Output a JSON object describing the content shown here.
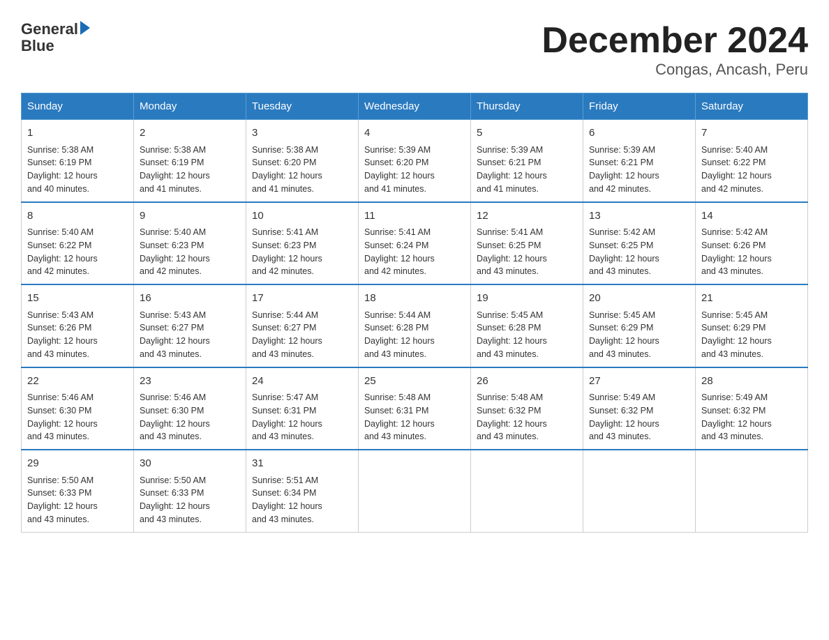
{
  "logo": {
    "line1": "General",
    "line2": "Blue"
  },
  "title": "December 2024",
  "subtitle": "Congas, Ancash, Peru",
  "days": [
    "Sunday",
    "Monday",
    "Tuesday",
    "Wednesday",
    "Thursday",
    "Friday",
    "Saturday"
  ],
  "weeks": [
    [
      {
        "num": "1",
        "sunrise": "5:38 AM",
        "sunset": "6:19 PM",
        "daylight": "12 hours and 40 minutes."
      },
      {
        "num": "2",
        "sunrise": "5:38 AM",
        "sunset": "6:19 PM",
        "daylight": "12 hours and 41 minutes."
      },
      {
        "num": "3",
        "sunrise": "5:38 AM",
        "sunset": "6:20 PM",
        "daylight": "12 hours and 41 minutes."
      },
      {
        "num": "4",
        "sunrise": "5:39 AM",
        "sunset": "6:20 PM",
        "daylight": "12 hours and 41 minutes."
      },
      {
        "num": "5",
        "sunrise": "5:39 AM",
        "sunset": "6:21 PM",
        "daylight": "12 hours and 41 minutes."
      },
      {
        "num": "6",
        "sunrise": "5:39 AM",
        "sunset": "6:21 PM",
        "daylight": "12 hours and 42 minutes."
      },
      {
        "num": "7",
        "sunrise": "5:40 AM",
        "sunset": "6:22 PM",
        "daylight": "12 hours and 42 minutes."
      }
    ],
    [
      {
        "num": "8",
        "sunrise": "5:40 AM",
        "sunset": "6:22 PM",
        "daylight": "12 hours and 42 minutes."
      },
      {
        "num": "9",
        "sunrise": "5:40 AM",
        "sunset": "6:23 PM",
        "daylight": "12 hours and 42 minutes."
      },
      {
        "num": "10",
        "sunrise": "5:41 AM",
        "sunset": "6:23 PM",
        "daylight": "12 hours and 42 minutes."
      },
      {
        "num": "11",
        "sunrise": "5:41 AM",
        "sunset": "6:24 PM",
        "daylight": "12 hours and 42 minutes."
      },
      {
        "num": "12",
        "sunrise": "5:41 AM",
        "sunset": "6:25 PM",
        "daylight": "12 hours and 43 minutes."
      },
      {
        "num": "13",
        "sunrise": "5:42 AM",
        "sunset": "6:25 PM",
        "daylight": "12 hours and 43 minutes."
      },
      {
        "num": "14",
        "sunrise": "5:42 AM",
        "sunset": "6:26 PM",
        "daylight": "12 hours and 43 minutes."
      }
    ],
    [
      {
        "num": "15",
        "sunrise": "5:43 AM",
        "sunset": "6:26 PM",
        "daylight": "12 hours and 43 minutes."
      },
      {
        "num": "16",
        "sunrise": "5:43 AM",
        "sunset": "6:27 PM",
        "daylight": "12 hours and 43 minutes."
      },
      {
        "num": "17",
        "sunrise": "5:44 AM",
        "sunset": "6:27 PM",
        "daylight": "12 hours and 43 minutes."
      },
      {
        "num": "18",
        "sunrise": "5:44 AM",
        "sunset": "6:28 PM",
        "daylight": "12 hours and 43 minutes."
      },
      {
        "num": "19",
        "sunrise": "5:45 AM",
        "sunset": "6:28 PM",
        "daylight": "12 hours and 43 minutes."
      },
      {
        "num": "20",
        "sunrise": "5:45 AM",
        "sunset": "6:29 PM",
        "daylight": "12 hours and 43 minutes."
      },
      {
        "num": "21",
        "sunrise": "5:45 AM",
        "sunset": "6:29 PM",
        "daylight": "12 hours and 43 minutes."
      }
    ],
    [
      {
        "num": "22",
        "sunrise": "5:46 AM",
        "sunset": "6:30 PM",
        "daylight": "12 hours and 43 minutes."
      },
      {
        "num": "23",
        "sunrise": "5:46 AM",
        "sunset": "6:30 PM",
        "daylight": "12 hours and 43 minutes."
      },
      {
        "num": "24",
        "sunrise": "5:47 AM",
        "sunset": "6:31 PM",
        "daylight": "12 hours and 43 minutes."
      },
      {
        "num": "25",
        "sunrise": "5:48 AM",
        "sunset": "6:31 PM",
        "daylight": "12 hours and 43 minutes."
      },
      {
        "num": "26",
        "sunrise": "5:48 AM",
        "sunset": "6:32 PM",
        "daylight": "12 hours and 43 minutes."
      },
      {
        "num": "27",
        "sunrise": "5:49 AM",
        "sunset": "6:32 PM",
        "daylight": "12 hours and 43 minutes."
      },
      {
        "num": "28",
        "sunrise": "5:49 AM",
        "sunset": "6:32 PM",
        "daylight": "12 hours and 43 minutes."
      }
    ],
    [
      {
        "num": "29",
        "sunrise": "5:50 AM",
        "sunset": "6:33 PM",
        "daylight": "12 hours and 43 minutes."
      },
      {
        "num": "30",
        "sunrise": "5:50 AM",
        "sunset": "6:33 PM",
        "daylight": "12 hours and 43 minutes."
      },
      {
        "num": "31",
        "sunrise": "5:51 AM",
        "sunset": "6:34 PM",
        "daylight": "12 hours and 43 minutes."
      },
      null,
      null,
      null,
      null
    ]
  ],
  "labels": {
    "sunrise": "Sunrise:",
    "sunset": "Sunset:",
    "daylight": "Daylight:"
  }
}
